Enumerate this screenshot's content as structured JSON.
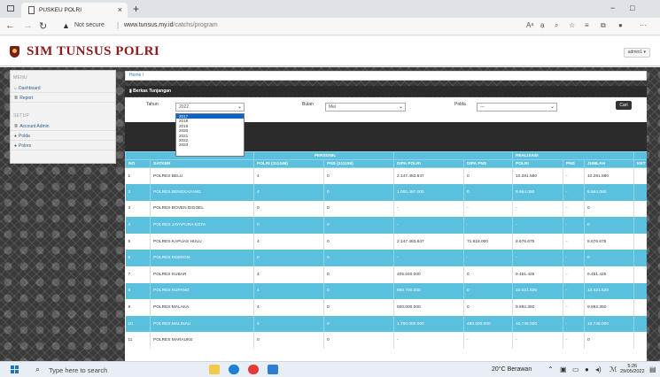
{
  "browser": {
    "tab_title": "PUSKEU POLRI",
    "close_glyph": "×",
    "new_tab_glyph": "+",
    "security_label": "Not secure",
    "url_host": "www.tunsus.my.id",
    "url_path": "/catchs/program",
    "minimize_glyph": "−",
    "restore_glyph": "□",
    "user_glyph": "●",
    "more_glyph": "···"
  },
  "app": {
    "title": "SIM TUNSUS POLRI",
    "user_button": "admin1 ▾",
    "brand_color": "#8b1a1a"
  },
  "sidebar": {
    "menu_heading": "MENU",
    "setup_heading": "SETUP",
    "items": [
      {
        "label": "Dashboard",
        "icon": "home-icon"
      },
      {
        "label": "Report",
        "icon": "list-icon"
      },
      {
        "label": "Account Admin",
        "icon": "list-icon"
      },
      {
        "label": "Polda",
        "icon": "pin-icon"
      },
      {
        "label": "Polres",
        "icon": "pin-icon"
      }
    ]
  },
  "breadcrumb": "Home /",
  "panel_title": "Berkas Tunjangan",
  "filters": {
    "tahun_label": "Tahun",
    "tahun_value": "2022",
    "bulan_label": "Bulan",
    "bulan_value": "Mei",
    "polda_label": "Polda",
    "polda_value": "---",
    "search_button": "Cari"
  },
  "year_options": [
    "2017",
    "2018",
    "2019",
    "2020",
    "2021",
    "2022",
    "2023"
  ],
  "year_selected_index": 0,
  "table": {
    "group_headers": {
      "personil": "PERSONIL",
      "realisasi": "REALISASI"
    },
    "columns": [
      "NO",
      "SATKER",
      "POLRI (311246)",
      "PNS (311156)",
      "DIPA POLRI",
      "DIPA PNS",
      "POLRI",
      "PNS",
      "JUMLAH",
      "KET"
    ],
    "rows": [
      [
        "1",
        "POLRES BELU",
        "4",
        "0",
        "2.147.483.647",
        "0",
        "10.281.580",
        "-",
        "10.281.580",
        ""
      ],
      [
        "2",
        "POLRES BENGKAYANG",
        "4",
        "0",
        "1.000.497.000",
        "0",
        "8.664.060",
        "-",
        "8.664.060",
        ""
      ],
      [
        "3",
        "POLRES BOVEN DIGOEL",
        "0",
        "0",
        "-",
        "-",
        "-",
        "-",
        "0",
        ""
      ],
      [
        "4",
        "POLRES JAYAPURA KOTA",
        "0",
        "0",
        "-",
        "-",
        "-",
        "-",
        "0",
        ""
      ],
      [
        "5",
        "POLRES KAPUAS HULU",
        "4",
        "0",
        "2.147.483.647",
        "71.818.000",
        "8.676.675",
        "-",
        "8.676.675",
        ""
      ],
      [
        "6",
        "POLRES KEEROM",
        "0",
        "0",
        "-",
        "-",
        "-",
        "-",
        "0",
        ""
      ],
      [
        "7",
        "POLRES KUBAR",
        "4",
        "0",
        "405.040.000",
        "0",
        "9.451.425",
        "-",
        "9.451.425",
        ""
      ],
      [
        "8",
        "POLRES KUPANG",
        "4",
        "0",
        "665.700.000",
        "0",
        "10.421.525",
        "-",
        "10.421.525",
        ""
      ],
      [
        "9",
        "POLRES MALAKA",
        "4",
        "0",
        "500.000.000",
        "0",
        "9.892.350",
        "-",
        "9.892.350",
        ""
      ],
      [
        "10",
        "POLRES MALINAU",
        "4",
        "0",
        "1.700.000.000",
        "460.000.000",
        "10.745.000",
        "-",
        "10.745.000",
        ""
      ],
      [
        "11",
        "POLRES MARAUKE",
        "0",
        "0",
        "-",
        "-",
        "-",
        "-",
        "0",
        ""
      ]
    ],
    "stripe_color": "#5bc0de"
  },
  "taskbar": {
    "search_placeholder": "Type here to search",
    "weather": "20°C  Berawan",
    "time": "5:26",
    "date": "29/05/2022"
  }
}
